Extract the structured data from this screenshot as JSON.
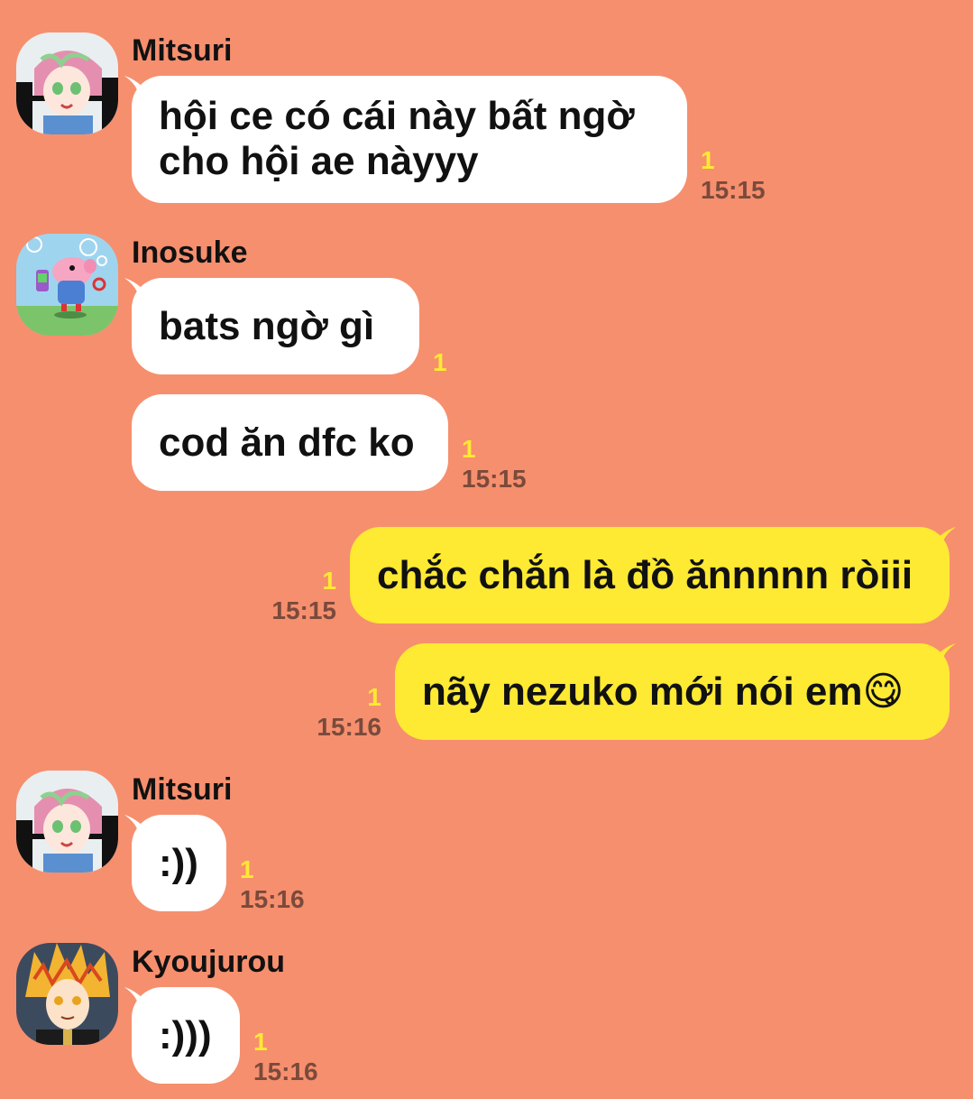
{
  "messages": [
    {
      "sender": "Mitsuri",
      "avatar_icon": "mitsuri-avatar-icon",
      "text": "hội ce có cái này bất ngờ cho hội ae nàyyy",
      "line1": "hội ce có cái này bất ngờ",
      "line2": "cho hội ae nàyyy",
      "unread": "1",
      "time": "15:15"
    },
    {
      "sender": "Inosuke",
      "avatar_icon": "peppa-pig-avatar-icon",
      "text": "bats ngờ gì",
      "unread": "1",
      "time": ""
    },
    {
      "sender": "Inosuke",
      "text": "cod ăn dfc ko",
      "unread": "1",
      "time": "15:15"
    },
    {
      "sender": "me",
      "text": "chắc chắn là đồ ănnnnn ròiii",
      "unread": "1",
      "time": "15:15"
    },
    {
      "sender": "me",
      "text": "nãy nezuko mới nói em😋",
      "unread": "1",
      "time": "15:16"
    },
    {
      "sender": "Mitsuri",
      "avatar_icon": "mitsuri-avatar-icon",
      "text": ":))",
      "unread": "1",
      "time": "15:16"
    },
    {
      "sender": "Kyoujurou",
      "avatar_icon": "kyoujurou-avatar-icon",
      "text": ":)))",
      "unread": "1",
      "time": "15:16"
    }
  ],
  "colors": {
    "background": "#f68f6e",
    "incoming_bubble": "#ffffff",
    "outgoing_bubble": "#fee933",
    "unread_count": "#fee933",
    "timestamp": "#7a4a3b"
  }
}
